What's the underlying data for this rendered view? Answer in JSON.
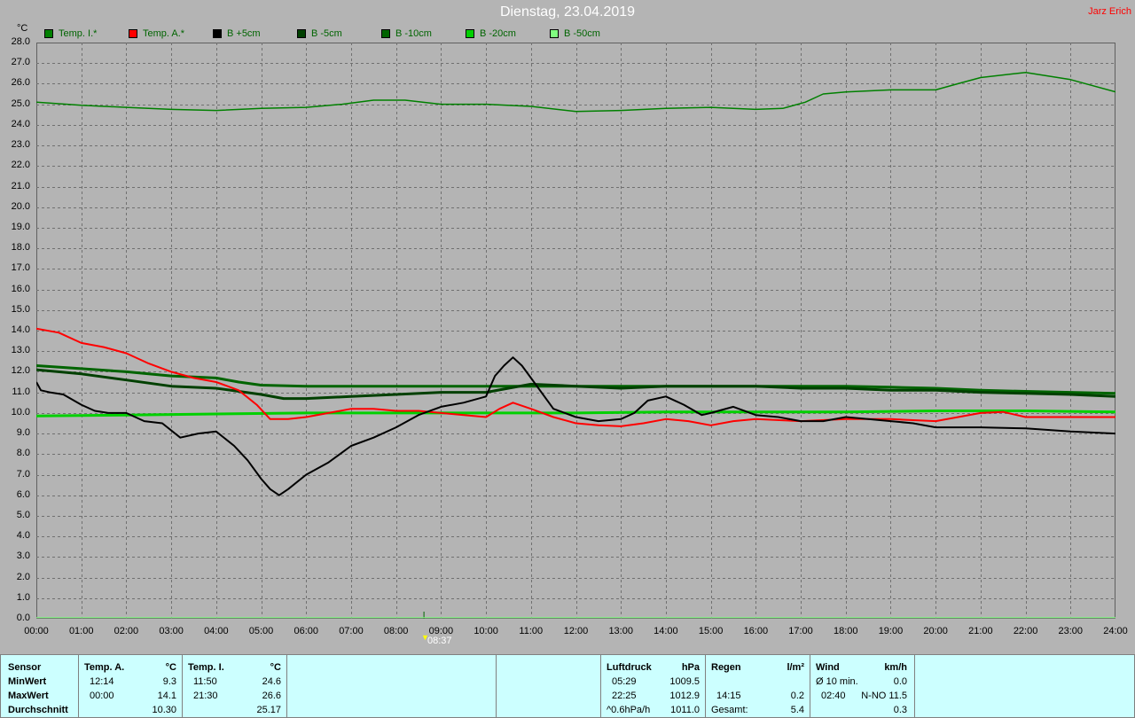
{
  "header": {
    "title": "Dienstag, 23.04.2019",
    "author": "Jarz Erich",
    "unit": "°C"
  },
  "legend": [
    {
      "label": "Temp. I.*",
      "color": "#008000"
    },
    {
      "label": "Temp. A.*",
      "color": "#ff0000"
    },
    {
      "label": "B +5cm",
      "color": "#000000"
    },
    {
      "label": "B -5cm",
      "color": "#004000"
    },
    {
      "label": "B -10cm",
      "color": "#006400"
    },
    {
      "label": "B -20cm",
      "color": "#00d000"
    },
    {
      "label": "B -50cm",
      "color": "#80ff80"
    }
  ],
  "marker": {
    "label": "08:37",
    "hour": 8.62
  },
  "chart_data": {
    "type": "line",
    "xlim": [
      0,
      24
    ],
    "ylim": [
      0,
      28
    ],
    "grid": true,
    "y_ticks": [
      "0.0",
      "1.0",
      "2.0",
      "3.0",
      "4.0",
      "5.0",
      "6.0",
      "7.0",
      "8.0",
      "9.0",
      "10.0",
      "11.0",
      "12.0",
      "13.0",
      "14.0",
      "15.0",
      "16.0",
      "17.0",
      "18.0",
      "19.0",
      "20.0",
      "21.0",
      "22.0",
      "23.0",
      "24.0",
      "25.0",
      "26.0",
      "27.0",
      "28.0"
    ],
    "x_ticks": [
      "00:00",
      "01:00",
      "02:00",
      "03:00",
      "04:00",
      "05:00",
      "06:00",
      "07:00",
      "08:00",
      "09:00",
      "10:00",
      "11:00",
      "12:00",
      "13:00",
      "14:00",
      "15:00",
      "16:00",
      "17:00",
      "18:00",
      "19:00",
      "20:00",
      "21:00",
      "22:00",
      "23:00",
      "24:00"
    ],
    "series": [
      {
        "name": "Temp. I.*",
        "color": "#008000",
        "width": 1.5,
        "x": [
          0,
          1,
          2,
          3,
          4,
          5,
          6,
          6.8,
          7.5,
          8.2,
          9,
          10,
          11,
          12,
          13,
          14,
          15,
          16,
          16.6,
          17.1,
          17.5,
          18,
          19,
          20,
          20.5,
          21,
          22,
          23,
          24
        ],
        "y": [
          25.1,
          24.95,
          24.85,
          24.75,
          24.7,
          24.8,
          24.85,
          25.0,
          25.2,
          25.2,
          25.0,
          25.0,
          24.9,
          24.65,
          24.7,
          24.8,
          24.85,
          24.75,
          24.8,
          25.1,
          25.5,
          25.6,
          25.7,
          25.7,
          26.0,
          26.3,
          26.55,
          26.2,
          25.6
        ]
      },
      {
        "name": "Temp. A.*",
        "color": "#ff0000",
        "width": 2,
        "x": [
          0,
          0.5,
          1,
          1.5,
          2,
          2.5,
          3,
          3.5,
          4,
          4.5,
          4.9,
          5.2,
          5.6,
          6,
          6.5,
          7,
          7.5,
          8,
          8.5,
          9,
          10,
          10.3,
          10.6,
          11,
          11.5,
          12,
          12.5,
          13,
          13.5,
          14,
          14.5,
          15,
          15.5,
          16,
          17,
          18,
          19,
          20,
          21,
          21.5,
          22,
          23,
          24
        ],
        "y": [
          14.1,
          13.9,
          13.4,
          13.2,
          12.9,
          12.4,
          12.0,
          11.7,
          11.5,
          11.1,
          10.4,
          9.7,
          9.7,
          9.8,
          10.0,
          10.2,
          10.2,
          10.1,
          10.1,
          10.0,
          9.8,
          10.2,
          10.5,
          10.2,
          9.8,
          9.5,
          9.4,
          9.35,
          9.5,
          9.7,
          9.6,
          9.4,
          9.6,
          9.7,
          9.6,
          9.7,
          9.7,
          9.6,
          10.0,
          10.05,
          9.8,
          9.8,
          9.8
        ]
      },
      {
        "name": "B +5cm",
        "color": "#000000",
        "width": 2,
        "x": [
          0,
          0.1,
          0.3,
          0.6,
          1,
          1.3,
          1.6,
          2,
          2.4,
          2.8,
          3.2,
          3.6,
          4,
          4.4,
          4.7,
          5,
          5.2,
          5.4,
          5.6,
          6,
          6.5,
          7,
          7.5,
          8,
          8.5,
          9,
          9.5,
          10,
          10.2,
          10.4,
          10.6,
          10.8,
          11,
          11.5,
          12,
          12.5,
          13,
          13.3,
          13.6,
          14,
          14.4,
          14.8,
          15,
          15.5,
          16,
          16.5,
          17,
          17.5,
          18,
          18.5,
          19,
          19.5,
          20,
          21,
          22,
          23,
          24
        ],
        "y": [
          11.5,
          11.1,
          11.0,
          10.9,
          10.4,
          10.1,
          10.0,
          10.0,
          9.6,
          9.5,
          8.8,
          9.0,
          9.1,
          8.4,
          7.7,
          6.8,
          6.3,
          6.0,
          6.3,
          7.0,
          7.6,
          8.4,
          8.8,
          9.3,
          9.9,
          10.3,
          10.5,
          10.8,
          11.8,
          12.3,
          12.7,
          12.3,
          11.7,
          10.2,
          9.8,
          9.6,
          9.7,
          10.0,
          10.6,
          10.8,
          10.4,
          9.9,
          10.0,
          10.3,
          9.9,
          9.8,
          9.6,
          9.6,
          9.8,
          9.7,
          9.6,
          9.5,
          9.3,
          9.3,
          9.25,
          9.1,
          9.0
        ]
      },
      {
        "name": "B -5cm",
        "color": "#004000",
        "width": 3,
        "x": [
          0,
          1,
          2,
          3,
          4,
          5,
          5.5,
          6,
          7,
          8,
          9,
          10,
          11,
          11.5,
          12,
          13,
          14,
          15,
          16,
          17,
          18,
          19,
          20,
          21,
          22,
          23,
          24
        ],
        "y": [
          12.1,
          11.9,
          11.6,
          11.3,
          11.2,
          10.9,
          10.7,
          10.7,
          10.8,
          10.9,
          11.0,
          11.0,
          11.4,
          11.35,
          11.3,
          11.2,
          11.3,
          11.3,
          11.3,
          11.2,
          11.2,
          11.1,
          11.1,
          11.0,
          10.95,
          10.9,
          10.8
        ]
      },
      {
        "name": "B -10cm",
        "color": "#006400",
        "width": 3,
        "x": [
          0,
          1,
          2,
          3,
          4,
          4.5,
          5,
          6,
          7,
          8,
          9,
          10,
          11,
          12,
          13,
          14,
          15,
          16,
          17,
          18,
          19,
          20,
          21,
          22,
          23,
          24
        ],
        "y": [
          12.3,
          12.15,
          12.0,
          11.8,
          11.7,
          11.5,
          11.35,
          11.3,
          11.3,
          11.3,
          11.3,
          11.3,
          11.3,
          11.3,
          11.3,
          11.3,
          11.3,
          11.3,
          11.3,
          11.3,
          11.25,
          11.2,
          11.1,
          11.05,
          11.0,
          10.95
        ]
      },
      {
        "name": "B -20cm",
        "color": "#00d000",
        "width": 3,
        "x": [
          0,
          2,
          4,
          6,
          8,
          10,
          12,
          14,
          16,
          18,
          20,
          22,
          24
        ],
        "y": [
          9.85,
          9.9,
          9.95,
          10.0,
          10.0,
          10.0,
          10.0,
          10.05,
          10.05,
          10.05,
          10.1,
          10.1,
          10.05
        ]
      },
      {
        "name": "B -50cm",
        "color": "#80ff80",
        "width": 1,
        "x": [
          0,
          24
        ],
        "y": [
          0.05,
          0.05
        ]
      }
    ]
  },
  "stats": {
    "labels": {
      "sensor": "Sensor",
      "min": "MinWert",
      "max": "MaxWert",
      "avg": "Durchschnitt"
    },
    "temp_a": {
      "header": "Temp. A.",
      "unit": "°C",
      "min_time": "12:14",
      "min_val": "9.3",
      "max_time": "00:00",
      "max_val": "14.1",
      "avg": "10.30"
    },
    "temp_i": {
      "header": "Temp. I.",
      "unit": "°C",
      "min_time": "11:50",
      "min_val": "24.6",
      "max_time": "21:30",
      "max_val": "26.6",
      "avg": "25.17"
    },
    "pressure": {
      "header": "Luftdruck",
      "unit": "hPa",
      "min_time": "05:29",
      "min_val": "1009.5",
      "max_time": "22:25",
      "max_val": "1012.9",
      "trend_label": "^0.6hPa/h",
      "trend_val": "1011.0"
    },
    "rain": {
      "header": "Regen",
      "unit": "l/m²",
      "max_time": "14:15",
      "max_val": "0.2",
      "total_label": "Gesamt:",
      "total_val": "5.4"
    },
    "wind": {
      "header": "Wind",
      "unit": "km/h",
      "avg_label": "Ø 10 min.",
      "avg_val": "0.0",
      "max_time": "02:40",
      "max_val": "N-NO 11.5",
      "daily_avg": "0.3"
    }
  }
}
